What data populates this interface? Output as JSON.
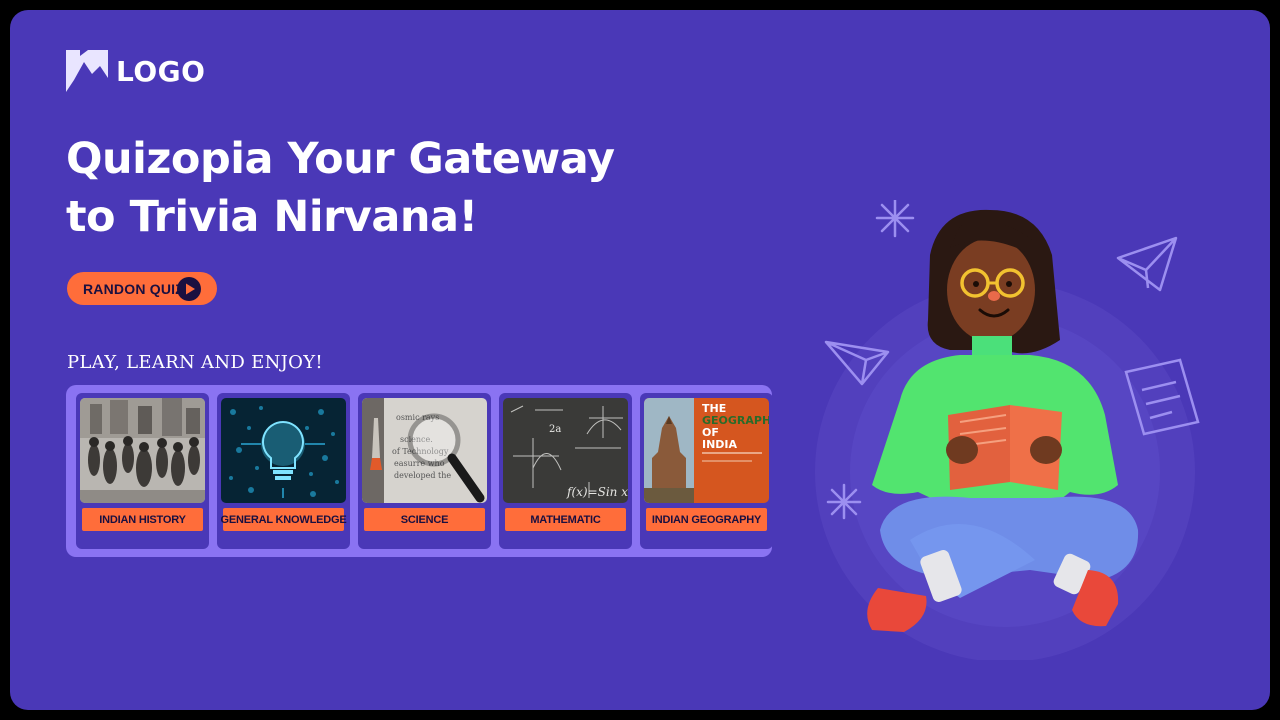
{
  "logo": {
    "text": "LOGO"
  },
  "hero": {
    "headline_line1": "Quizopia Your Gateway",
    "headline_line2": "to Trivia Nirvana!",
    "random_quiz_label": "RANDON QUIZ"
  },
  "categories": {
    "heading": "PLAY, LEARN AND ENJOY!",
    "items": [
      {
        "label": "INDIAN HISTORY"
      },
      {
        "label": "GENERAL KNOWLEDGE"
      },
      {
        "label": "SCIENCE"
      },
      {
        "label": "MATHEMATIC"
      },
      {
        "label": "INDIAN GEOGRAPHY"
      }
    ]
  },
  "thumbnails": {
    "science_text": [
      "osmic rays",
      "science.",
      "of Technology",
      "easurre who",
      "developed the"
    ],
    "math_text": [
      "2a",
      "f(x)=Sin x"
    ],
    "geo_book_title": [
      "THE",
      "GEOGRAPHY",
      "OF",
      "INDIA"
    ]
  },
  "colors": {
    "background": "#4a38b7",
    "accent": "#ff6d3a",
    "panel": "#8a73f2"
  }
}
